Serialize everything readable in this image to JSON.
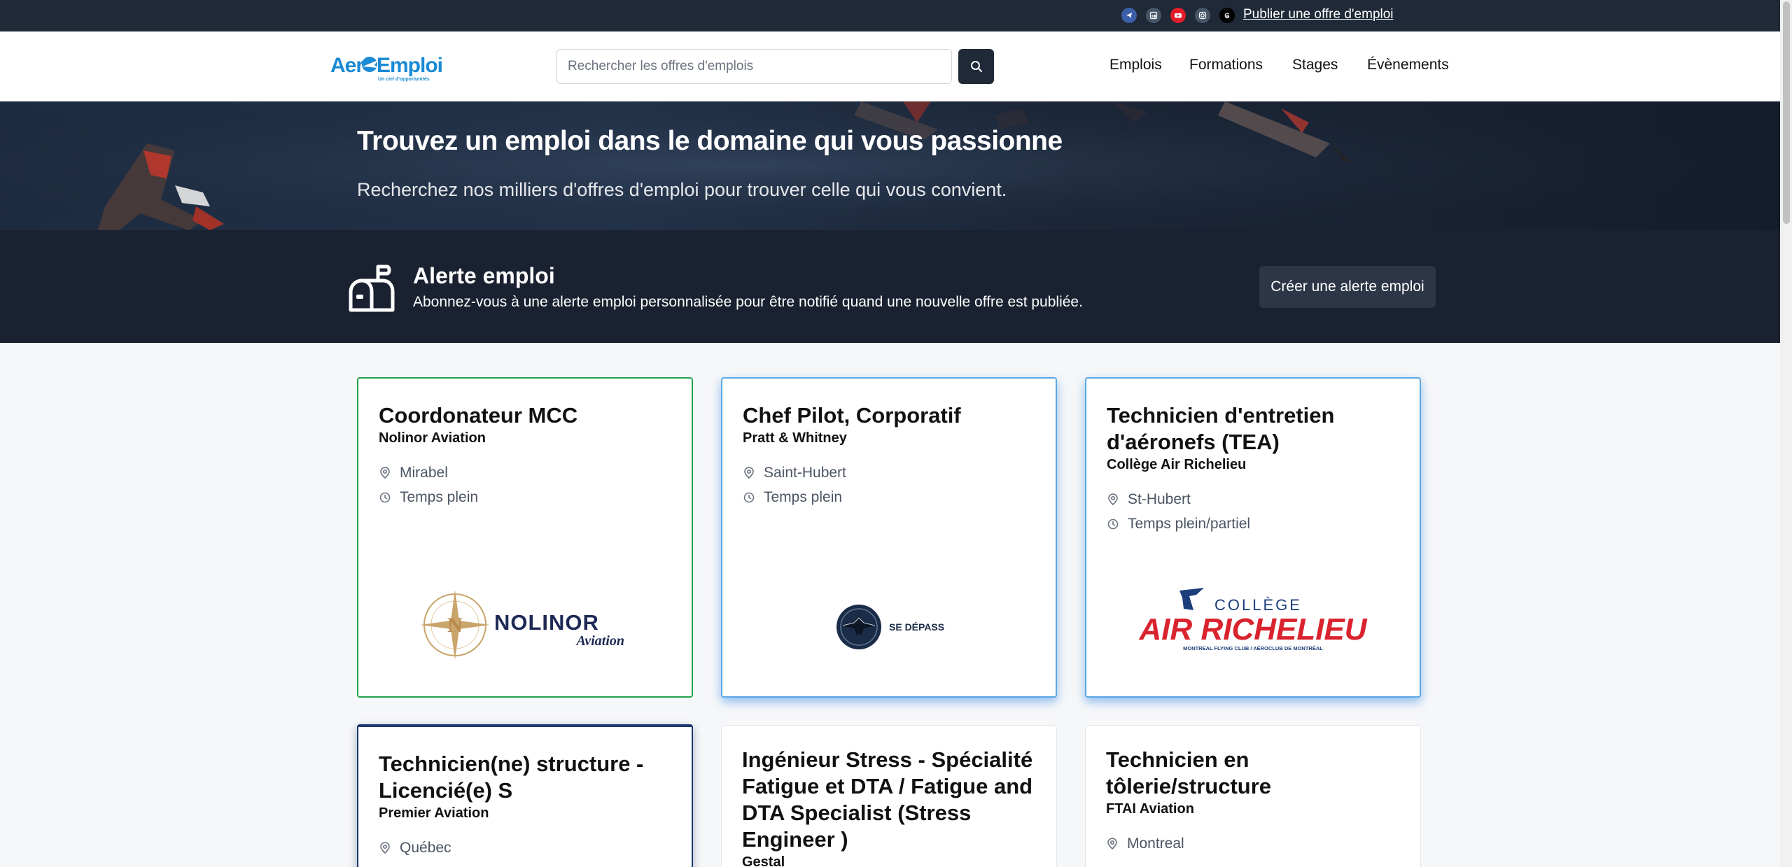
{
  "topbar": {
    "icons": [
      "telegram-icon",
      "linkedin-icon",
      "youtube-icon",
      "instagram-icon",
      "threads-icon"
    ],
    "publish_label": "Publier une offre d'emploi"
  },
  "header": {
    "logo_text": "AeroEmploi",
    "logo_tagline": "Un ciel d'opportunités",
    "search_placeholder": "Rechercher les offres d'emplois",
    "nav": [
      "Emplois",
      "Formations",
      "Stages",
      "Évènements"
    ]
  },
  "hero": {
    "title": "Trouvez un emploi dans le domaine qui vous passionne",
    "subtitle": "Recherchez nos milliers d'offres d'emploi pour trouver celle qui vous convient."
  },
  "alert": {
    "title": "Alerte emploi",
    "subtitle": "Abonnez-vous à une alerte emploi personnalisée pour être notifié quand une nouvelle offre est publiée.",
    "button_label": "Créer une alerte emploi"
  },
  "cards": [
    {
      "title": "Coordonateur MCC",
      "company": "Nolinor Aviation",
      "location": "Mirabel",
      "type": "Temps plein",
      "logo_main": "NOLINOR",
      "logo_sub": "Aviation"
    },
    {
      "title": "Chef Pilot, Corporatif",
      "company": "Pratt & Whitney",
      "location": "Saint-Hubert",
      "type": "Temps plein",
      "logo_main": "SE DÉPASSER"
    },
    {
      "title": "Technicien d'entretien d'aéronefs (TEA)",
      "company": "Collège Air Richelieu",
      "location": "St-Hubert",
      "type": "Temps plein/partiel",
      "logo_top": "COLLÈGE",
      "logo_main": "AIR RICHELIEU",
      "logo_sub": "MONTREAL FLYING CLUB / AÉROCLUB DE MONTRÉAL"
    },
    {
      "title": "Technicien(ne) structure - Licencié(e) S",
      "company": "Premier Aviation",
      "location": "Québec"
    },
    {
      "title": "Ingénieur Stress - Spécialité Fatigue et DTA / Fatigue and DTA Specialist (Stress Engineer )",
      "company": "Gestal"
    },
    {
      "title": "Technicien en tôlerie/structure",
      "company": "FTAI Aviation",
      "location": "Montreal"
    }
  ],
  "colors": {
    "topbar": "#1f2937",
    "hero_dark": "#1a2130",
    "green_border": "#22a34a",
    "blue_border": "#5aa7e4",
    "navy_border": "#1e3a6e",
    "logo_blue": "#1a8ad4",
    "richelieu_red": "#d9232e",
    "richelieu_navy": "#1b3d7a"
  }
}
